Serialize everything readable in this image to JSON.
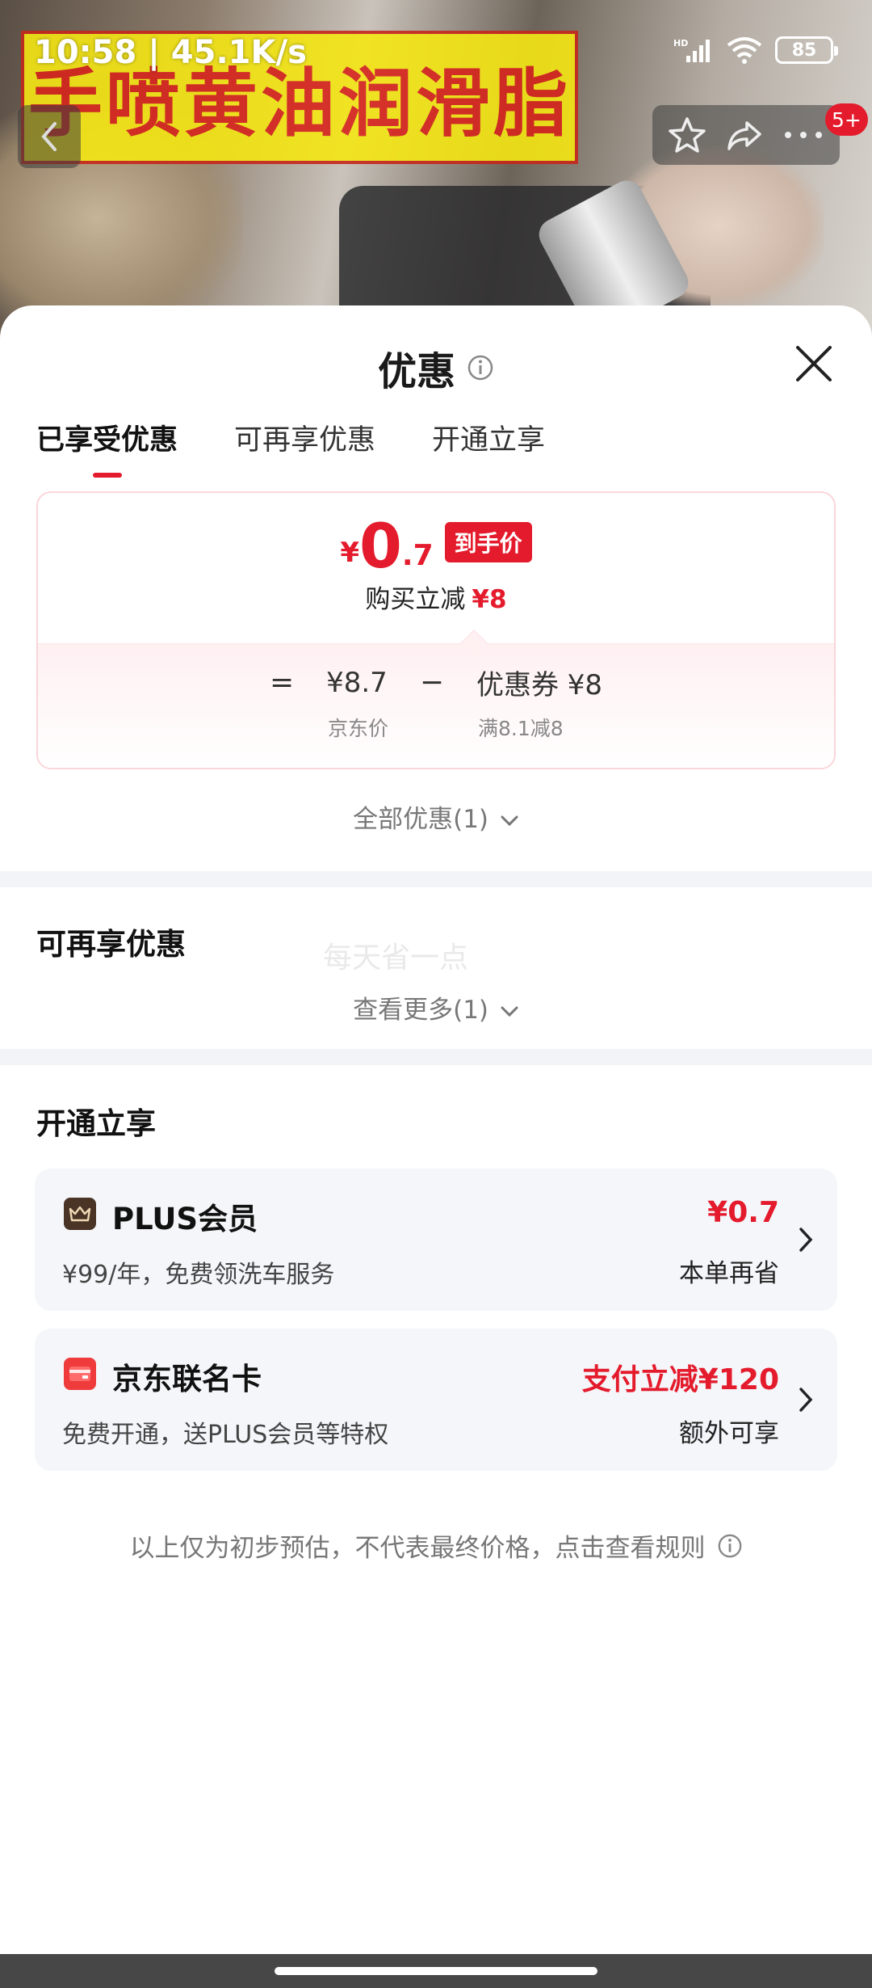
{
  "status_bar": {
    "time": "10:58 | 45.1K/s",
    "battery": "85"
  },
  "video": {
    "banner_text": "手喷黄油润滑脂",
    "badge": "5+"
  },
  "sheet": {
    "title": "优惠",
    "tabs": [
      {
        "label": "已享受优惠",
        "active": true
      },
      {
        "label": "可再享优惠",
        "active": false
      },
      {
        "label": "开通立享",
        "active": false
      }
    ],
    "price_card": {
      "currency": "¥",
      "final_int": "0",
      "final_dec": ".7",
      "final_tag": "到手价",
      "reduce_label": "购买立减",
      "reduce_value": "¥8",
      "eq": "=",
      "jd_price": "¥8.7",
      "minus": "−",
      "coupon": "优惠券 ¥8",
      "jd_price_label": "京东价",
      "coupon_label": "满8.1减8"
    },
    "all_offers": "全部优惠(1)",
    "more_section": {
      "title": "可再享优惠",
      "watermark": "每天省一点",
      "see_more": "查看更多(1)"
    },
    "open_section": {
      "title": "开通立享",
      "cards": [
        {
          "name": "PLUS会员",
          "desc": "¥99/年，免费领洗车服务",
          "amount": "¥0.7",
          "sub": "本单再省"
        },
        {
          "name": "京东联名卡",
          "desc": "免费开通，送PLUS会员等特权",
          "amount": "支付立减¥120",
          "sub": "额外可享"
        }
      ]
    },
    "disclaimer": "以上仅为初步预估，不代表最终价格，点击查看规则"
  },
  "colors": {
    "accent_red": "#e41b2c",
    "plus_brown": "#4a3426",
    "card_bg": "#f5f6fa"
  }
}
